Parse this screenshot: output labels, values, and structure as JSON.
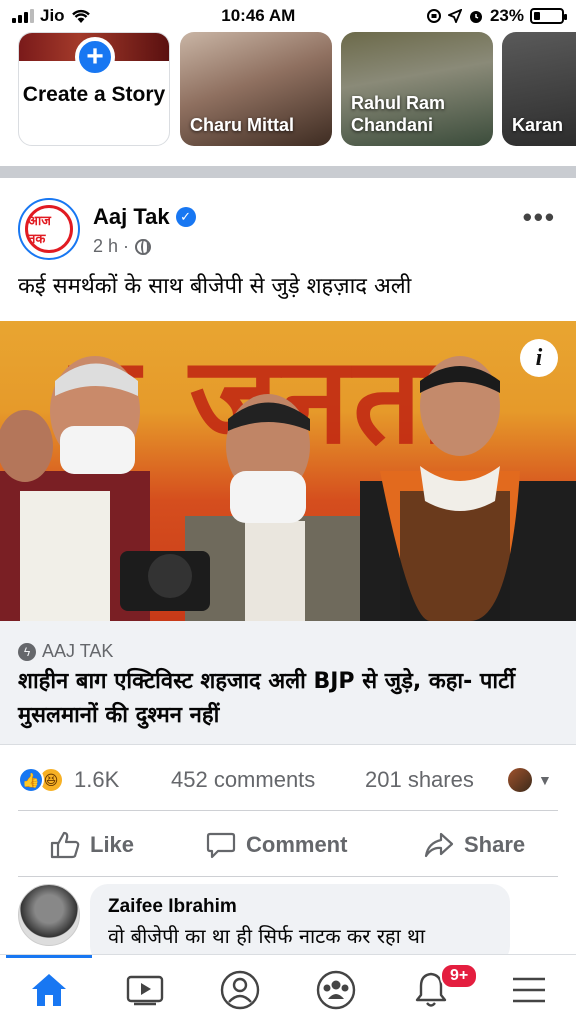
{
  "status_bar": {
    "carrier": "Jio",
    "time": "10:46 AM",
    "battery": "23%",
    "battery_level": 0.23
  },
  "stories": {
    "create_label": "Create a Story",
    "items": [
      {
        "name": "Charu Mittal"
      },
      {
        "name": "Rahul Ram Chandani"
      },
      {
        "name": "Karan"
      }
    ]
  },
  "post": {
    "page_name": "Aaj Tak",
    "logo_text": "आज तक",
    "time": "2 h ·",
    "caption": "कई समर्थकों के साथ बीजेपी से जुड़े शहज़ाद अली",
    "photo_banner": "य जनता",
    "link": {
      "source": "AAJ TAK",
      "title": "शाहीन बाग एक्टिविस्ट शहजाद अली BJP से जुड़े, कहा- पार्टी मुसलमानों की दुश्मन नहीं"
    },
    "stats": {
      "reactions": "1.6K",
      "comments": "452 comments",
      "shares": "201 shares"
    },
    "actions": {
      "like": "Like",
      "comment": "Comment",
      "share": "Share"
    }
  },
  "comment": {
    "author": "Zaifee Ibrahim",
    "text": "वो बीजेपी का था ही सिर्फ नाटक कर रहा था"
  },
  "bottom_nav": {
    "notifications_badge": "9+",
    "accent": "#1877f2"
  }
}
